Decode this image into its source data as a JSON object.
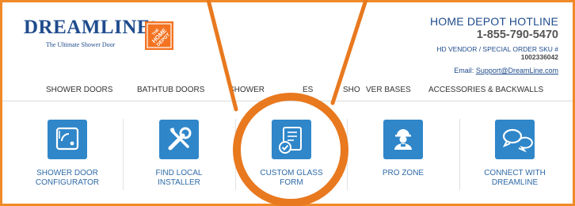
{
  "brand": {
    "name": "DREAMLINE",
    "tagline": "The Ultimate Shower Door",
    "partner_logo_text": "THE HOME DEPOT"
  },
  "contact": {
    "hotline_label": "HOME DEPOT HOTLINE",
    "phone": "1-855-790-5470",
    "vendor_label": "HD VENDOR / SPECIAL ORDER SKU #",
    "sku": "1002336042",
    "email_label": "Email:",
    "email": "Support@DreamLine.com"
  },
  "nav": {
    "items": [
      "SHOWER DOORS",
      "BATHTUB DOORS",
      "SHOWER",
      "ES",
      "SHO",
      "VER BASES",
      "ACCESSORIES & BACKWALLS"
    ]
  },
  "tiles": [
    {
      "line1": "SHOWER DOOR",
      "line2": "CONFIGURATOR",
      "icon": "shower-door-icon"
    },
    {
      "line1": "FIND LOCAL",
      "line2": "INSTALLER",
      "icon": "tools-icon"
    },
    {
      "line1": "CUSTOM GLASS",
      "line2": "FORM",
      "icon": "document-check-icon"
    },
    {
      "line1": "PRO ZONE",
      "line2": "",
      "icon": "contractor-icon"
    },
    {
      "line1": "CONNECT WITH",
      "line2": "DREAMLINE",
      "icon": "chat-bubbles-icon"
    }
  ],
  "colors": {
    "frame": "#f08a28",
    "annotation": "#e8791f",
    "brand_blue": "#1f4c8d",
    "icon_blue": "#2f86c9"
  }
}
